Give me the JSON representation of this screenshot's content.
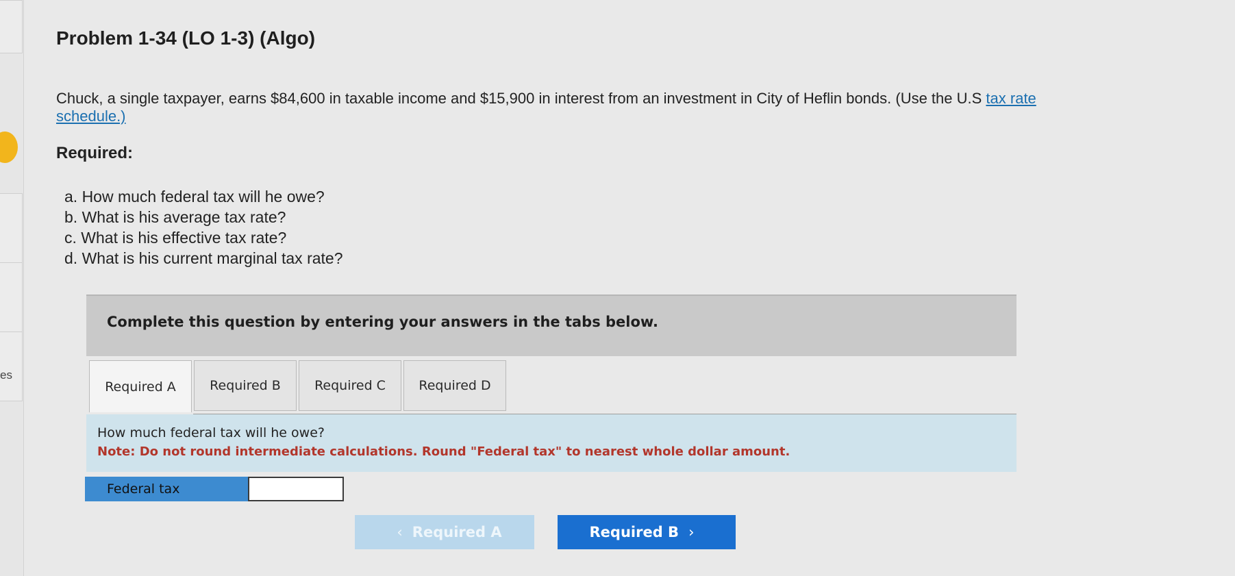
{
  "problem": {
    "title": "Problem 1-34 (LO 1-3) (Algo)",
    "intro_text": "Chuck, a single taxpayer, earns $84,600 in taxable income and $15,900 in interest from an investment in City of Heflin bonds. (Use the U.S ",
    "link_text": "tax rate schedule.)",
    "required_heading": "Required:",
    "questions": [
      "a. How much federal tax will he owe?",
      "b. What is his average tax rate?",
      "c. What is his effective tax rate?",
      "d. What is his current marginal tax rate?"
    ]
  },
  "left_rail": {
    "partial_text": "es"
  },
  "instruction": "Complete this question by entering your answers in the tabs below.",
  "tabs": [
    {
      "label": "Required A",
      "active": true
    },
    {
      "label": "Required B",
      "active": false
    },
    {
      "label": "Required C",
      "active": false
    },
    {
      "label": "Required D",
      "active": false
    }
  ],
  "panel": {
    "question": "How much federal tax will he owe?",
    "note": "Note: Do not round intermediate calculations. Round \"Federal tax\" to nearest whole dollar amount."
  },
  "answer_field": {
    "label": "Federal tax",
    "value": ""
  },
  "navigation": {
    "prev_label": "Required A",
    "next_label": "Required B",
    "prev_chevron": "‹",
    "next_chevron": "›"
  },
  "colors": {
    "tab_panel_bg": "#cfe3ec",
    "note_red": "#b2362b",
    "field_label_blue": "#3d8bd0",
    "next_button_blue": "#1a6fd0",
    "link_blue": "#1a6fb0",
    "badge_yellow": "#f2b51c"
  }
}
